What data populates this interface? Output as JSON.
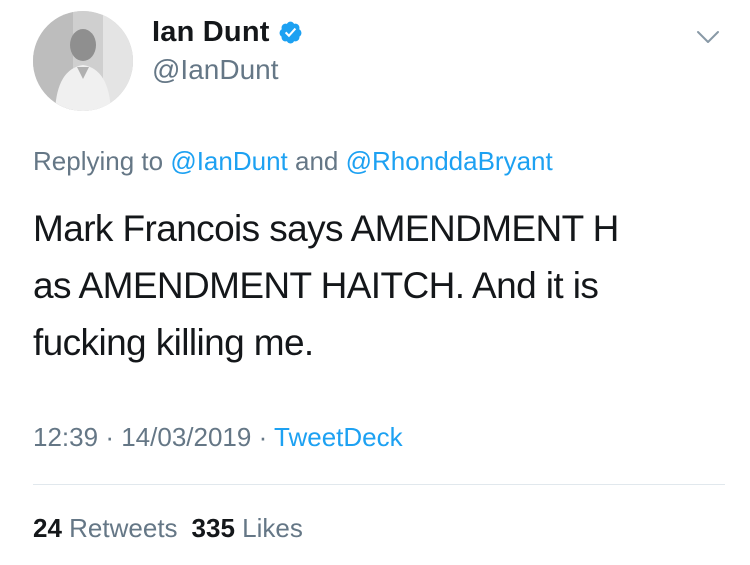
{
  "tweet": {
    "author": {
      "display_name": "Ian Dunt",
      "handle": "@IanDunt",
      "verified": true
    },
    "reply": {
      "prefix": "Replying to",
      "mention_1": "@IanDunt",
      "connector": "and",
      "mention_2": "@RhonddaBryant"
    },
    "text_lines": [
      "Mark Francois says AMENDMENT H",
      "as AMENDMENT HAITCH. And it is",
      "fucking killing me."
    ],
    "meta": {
      "time": "12:39",
      "sep_1": "·",
      "date": "14/03/2019",
      "sep_2": "·",
      "source": "TweetDeck"
    },
    "stats": {
      "retweets_count": "24",
      "retweets_label": "Retweets",
      "likes_count": "335",
      "likes_label": "Likes"
    }
  },
  "colors": {
    "text": "#14171a",
    "secondary": "#657786",
    "link": "#1da1f2",
    "verified": "#1da1f2",
    "divider": "#e1e8ed"
  },
  "icons": {
    "verified": "verified-badge-icon",
    "menu": "chevron-down-icon"
  }
}
